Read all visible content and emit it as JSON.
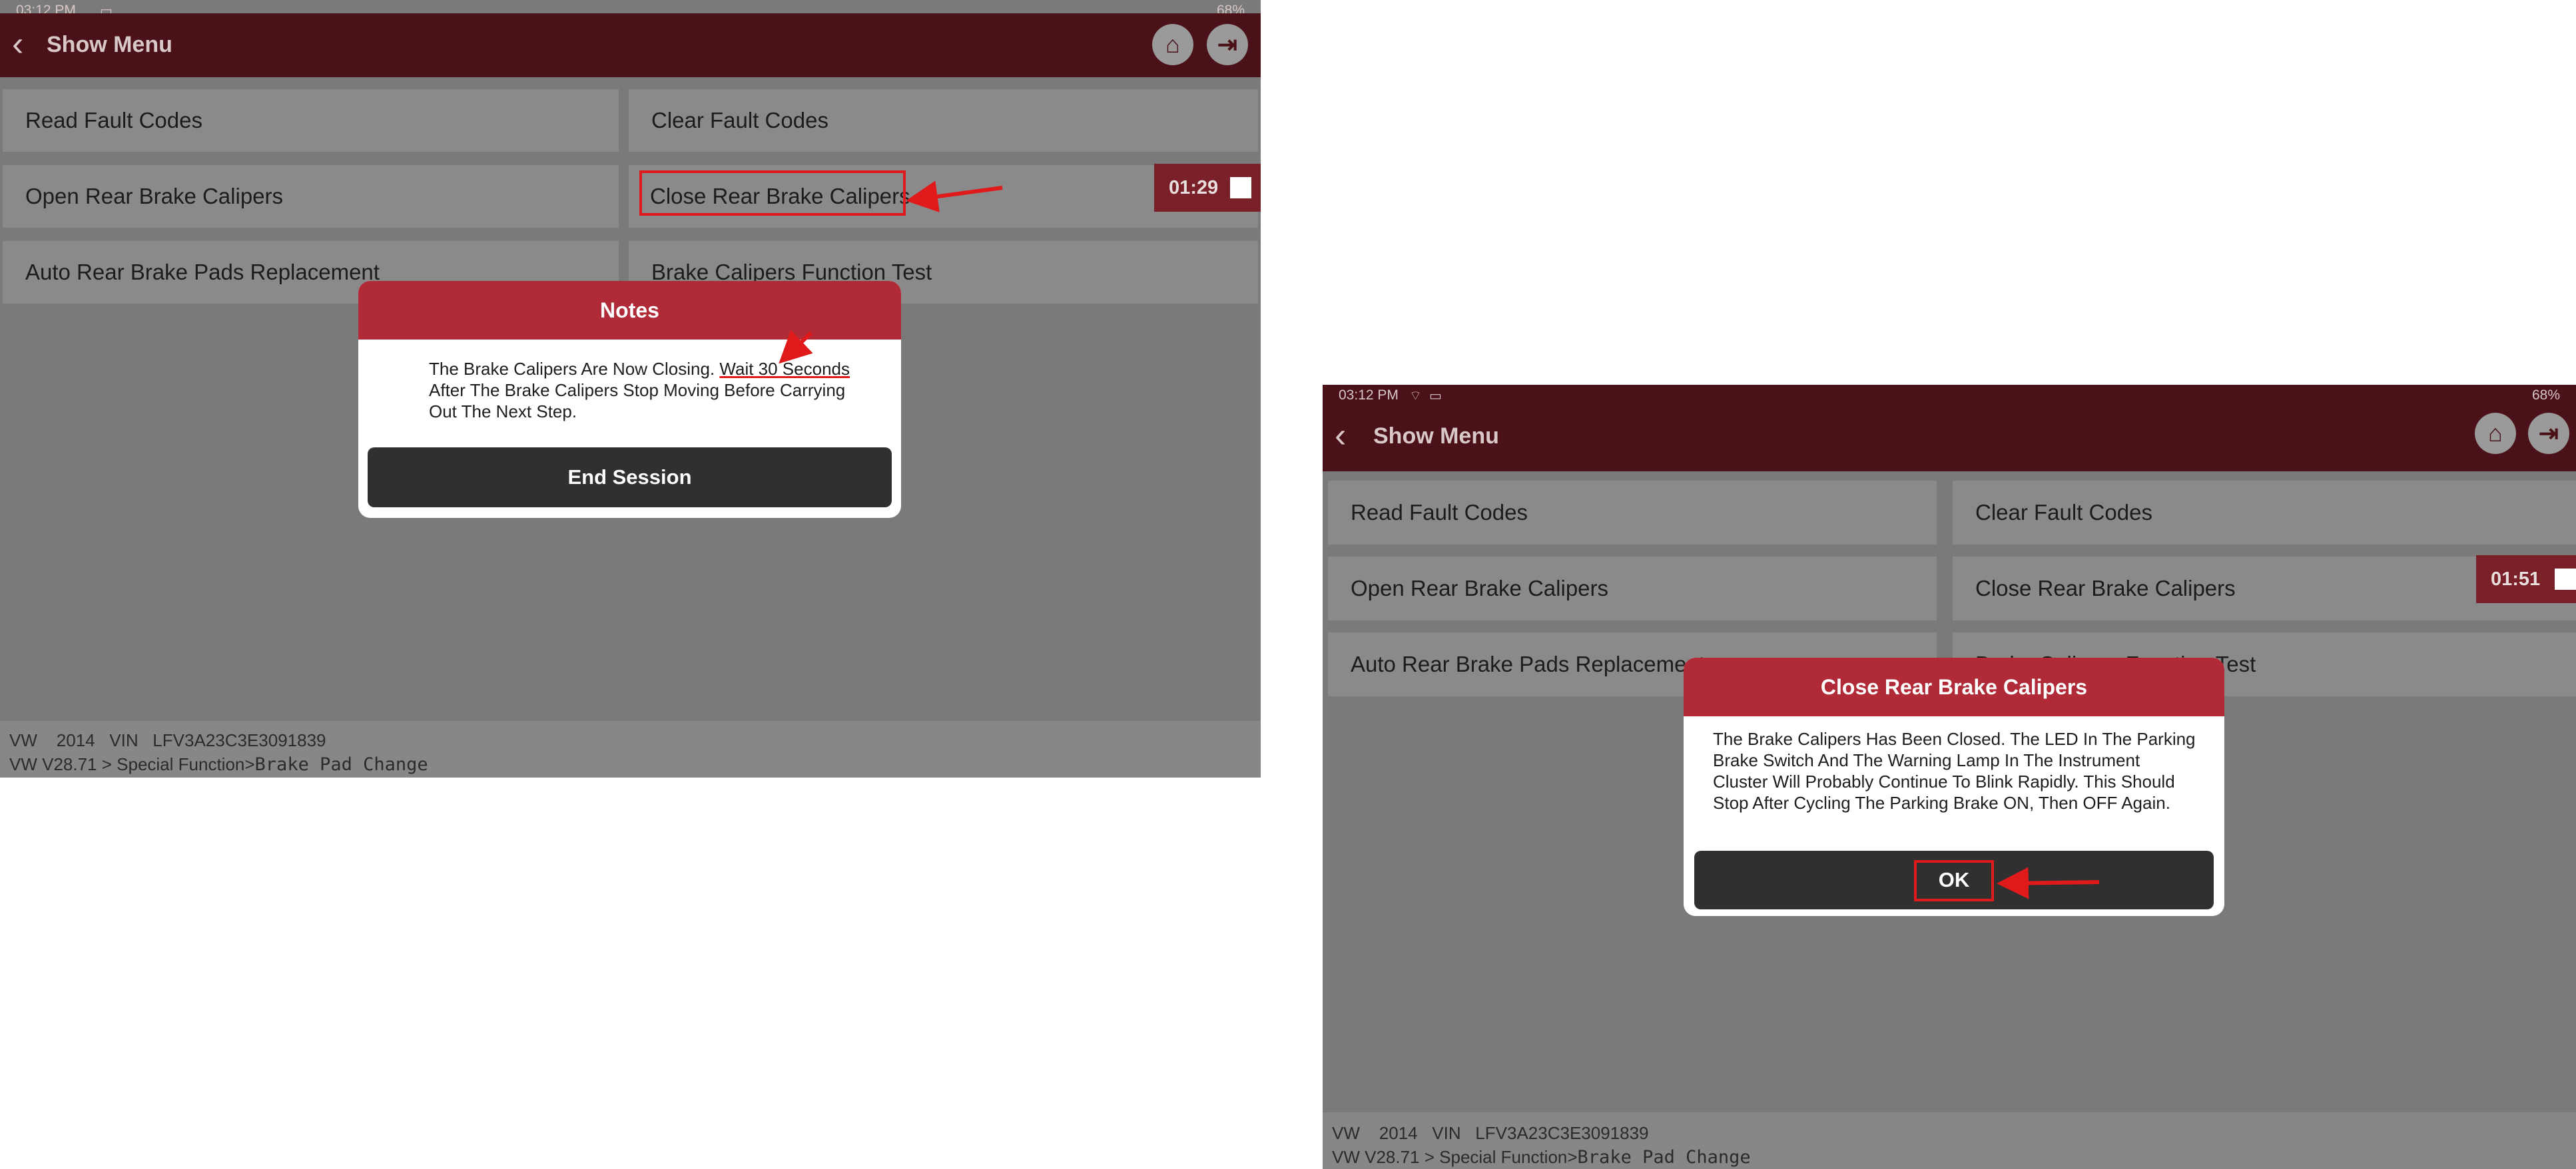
{
  "left": {
    "status_time": "03:12 PM",
    "status_battery": "68%",
    "header_title": "Show Menu",
    "menu": [
      "Read Fault Codes",
      "Clear Fault Codes",
      "Open Rear Brake Calipers",
      "Close Rear Brake Calipers",
      "Auto Rear Brake Pads Replacement",
      "Brake Calipers Function Test"
    ],
    "timer": "01:29",
    "dialog": {
      "title": "Notes",
      "body_before": "The Brake Calipers Are Now Closing. ",
      "body_highlight": "Wait 30 Seconds",
      "body_after": " After The Brake Calipers Stop Moving Before Carrying Out The Next Step.",
      "button": "End Session"
    },
    "footer": {
      "line1": "VW    2014   VIN   LFV3A23C3E3091839",
      "path": "VW V28.71 > Special Function>",
      "function": "Brake Pad Change"
    }
  },
  "right": {
    "status_time": "03:12 PM",
    "status_battery": "68%",
    "header_title": "Show Menu",
    "menu": [
      "Read Fault Codes",
      "Clear Fault Codes",
      "Open Rear Brake Calipers",
      "Close Rear Brake Calipers",
      "Auto Rear Brake Pads Replacement",
      "Brake Calipers Function Test"
    ],
    "timer": "01:51",
    "dialog": {
      "title": "Close Rear Brake Calipers",
      "body": "The Brake Calipers Has Been Closed. The LED In The Parking Brake Switch And The Warning Lamp In The Instrument Cluster Will Probably Continue To Blink Rapidly. This Should Stop After Cycling The Parking Brake ON, Then OFF Again.",
      "button": "OK"
    },
    "footer": {
      "line1": "VW    2014   VIN   LFV3A23C3E3091839",
      "path": "VW V28.71 > Special Function>",
      "function": "Brake Pad Change"
    }
  },
  "colors": {
    "header": "#4a1218",
    "dialog_title": "#b02a37",
    "annotation": "#e01a1a"
  }
}
